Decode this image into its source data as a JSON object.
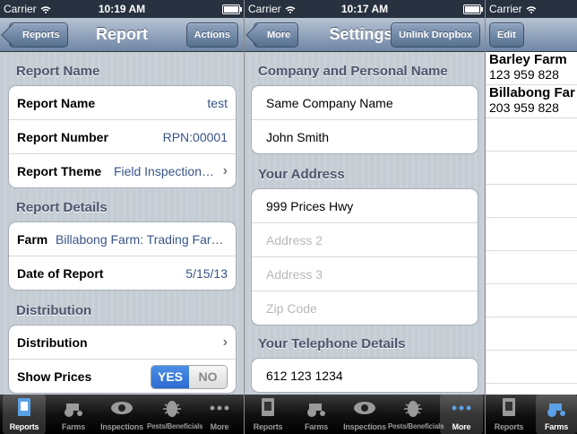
{
  "screen1": {
    "status": {
      "carrier": "Carrier",
      "time": "10:19 AM"
    },
    "nav": {
      "back": "Reports",
      "title": "Report",
      "action": "Actions"
    },
    "sections": {
      "name_header": "Report Name",
      "details_header": "Report Details",
      "distribution_header": "Distribution"
    },
    "rows": {
      "report_name_label": "Report Name",
      "report_name_value": "test",
      "report_number_label": "Report Number",
      "report_number_value": "RPN:00001",
      "report_theme_label": "Report Theme",
      "report_theme_value": "Field Inspection…",
      "farm_label": "Farm",
      "farm_value": "Billabong Farm: Trading Far…",
      "date_label": "Date of Report",
      "date_value": "5/15/13",
      "distribution_label": "Distribution",
      "show_prices_label": "Show Prices",
      "toggle_yes": "YES",
      "toggle_no": "NO"
    }
  },
  "screen2": {
    "status": {
      "carrier": "Carrier",
      "time": "10:17 AM"
    },
    "nav": {
      "back": "More",
      "title": "Settings",
      "action": "Unlink Dropbox"
    },
    "sections": {
      "company_header": "Company and Personal Name",
      "address_header": "Your Address",
      "phone_header": "Your Telephone Details"
    },
    "fields": {
      "company": "Same Company Name",
      "person": "John Smith",
      "street": "999 Prices Hwy",
      "address2_placeholder": "Address 2",
      "address3_placeholder": "Address 3",
      "zip_placeholder": "Zip Code",
      "phone": "612 123 1234"
    }
  },
  "screen3": {
    "status": {
      "carrier": "Carrier"
    },
    "nav": {
      "edit": "Edit"
    },
    "farms": [
      {
        "name": "Barley Farm",
        "phone": "123 959 828"
      },
      {
        "name": "Billabong Far",
        "phone": "203 959 828"
      }
    ]
  },
  "tabs": {
    "reports": "Reports",
    "farms": "Farms",
    "inspections": "Inspections",
    "pests": "Pests/Beneficials",
    "more": "More"
  },
  "colors": {
    "nav_blue": "#6f86a5",
    "value_blue": "#385487",
    "toggle_blue": "#2d6bd2"
  }
}
